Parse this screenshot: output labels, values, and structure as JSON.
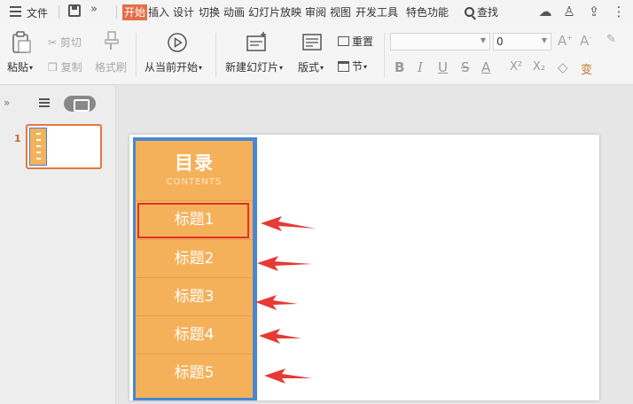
{
  "menubar": {
    "file_label": "文件",
    "more_label": "»",
    "tabs": [
      "开始",
      "插入",
      "设计",
      "切换",
      "动画",
      "幻灯片放映",
      "审阅",
      "视图",
      "开发工具",
      "特色功能"
    ],
    "active_tab": "开始",
    "search_label": "查找",
    "accent_color": "#e46f47"
  },
  "ribbon": {
    "paste_label": "粘贴",
    "cut_label": "剪切",
    "copy_label": "复制",
    "format_painter_label": "格式刷",
    "play_label": "从当前开始",
    "new_slide_label": "新建幻灯片",
    "layout_label": "版式",
    "reset_label": "重置",
    "section_label": "节",
    "font_name_value": "",
    "font_size_value": "0",
    "format_buttons": [
      "B",
      "I",
      "U",
      "S",
      "A",
      "X²",
      "X₂",
      "◇",
      "变"
    ]
  },
  "left_pane": {
    "expand_label": "»",
    "slide_number": "1"
  },
  "slide": {
    "toc_title": "目录",
    "toc_subtitle": "CONTENTS",
    "items": [
      "标题1",
      "标题2",
      "标题3",
      "标题4",
      "标题5"
    ],
    "toc_bg_color": "#f5b15a",
    "toc_border_color": "#4a86d3",
    "highlight_color": "#e0302c",
    "arrow_color": "#e53a35"
  }
}
